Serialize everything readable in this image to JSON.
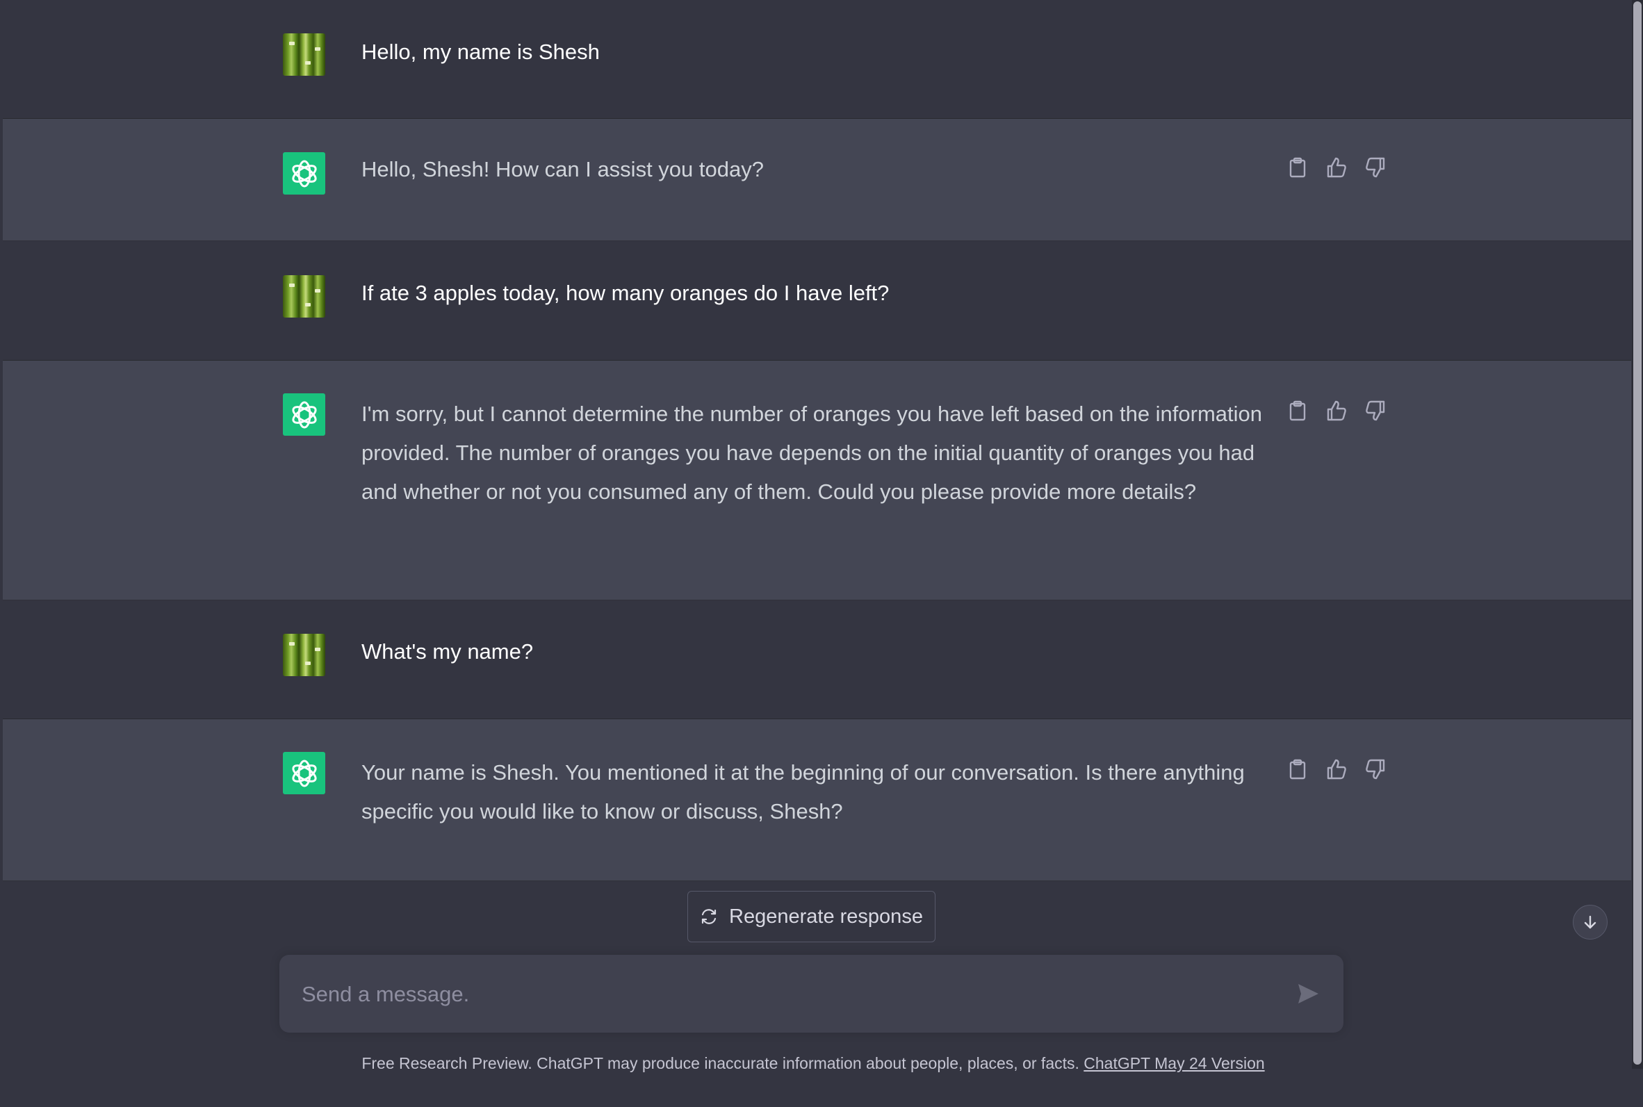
{
  "colors": {
    "page_bg": "#343541",
    "assistant_row_bg": "#444654",
    "assistant_avatar": "#19c37d",
    "composer_bg": "#40414f"
  },
  "conversation": {
    "messages": [
      {
        "role": "user",
        "avatar_icon": "bamboo-avatar-icon",
        "text": "Hello, my name is Shesh"
      },
      {
        "role": "assistant",
        "avatar_icon": "openai-logo-icon",
        "text": "Hello, Shesh! How can I assist you today?",
        "actions": [
          "copy-icon",
          "thumbs-up-icon",
          "thumbs-down-icon"
        ]
      },
      {
        "role": "user",
        "avatar_icon": "bamboo-avatar-icon",
        "text": "If ate 3 apples today, how many oranges do I have left?"
      },
      {
        "role": "assistant",
        "avatar_icon": "openai-logo-icon",
        "text": "I'm sorry, but I cannot determine the number of oranges you have left based on the information provided. The number of oranges you have depends on the initial quantity of oranges you had and whether or not you consumed any of them. Could you please provide more details?",
        "actions": [
          "copy-icon",
          "thumbs-up-icon",
          "thumbs-down-icon"
        ]
      },
      {
        "role": "user",
        "avatar_icon": "bamboo-avatar-icon",
        "text": "What's my name?"
      },
      {
        "role": "assistant",
        "avatar_icon": "openai-logo-icon",
        "text": "Your name is Shesh. You mentioned it at the beginning of our conversation. Is there anything specific you would like to know or discuss, Shesh?",
        "actions": [
          "copy-icon",
          "thumbs-up-icon",
          "thumbs-down-icon"
        ]
      }
    ]
  },
  "regenerate": {
    "icon": "refresh-icon",
    "label": "Regenerate response"
  },
  "scroll_down": {
    "icon": "arrow-down-icon"
  },
  "composer": {
    "placeholder": "Send a message.",
    "value": "",
    "send_icon": "send-icon"
  },
  "footer": {
    "text": "Free Research Preview. ChatGPT may produce inaccurate information about people, places, or facts.",
    "link_text": "ChatGPT May 24 Version"
  }
}
